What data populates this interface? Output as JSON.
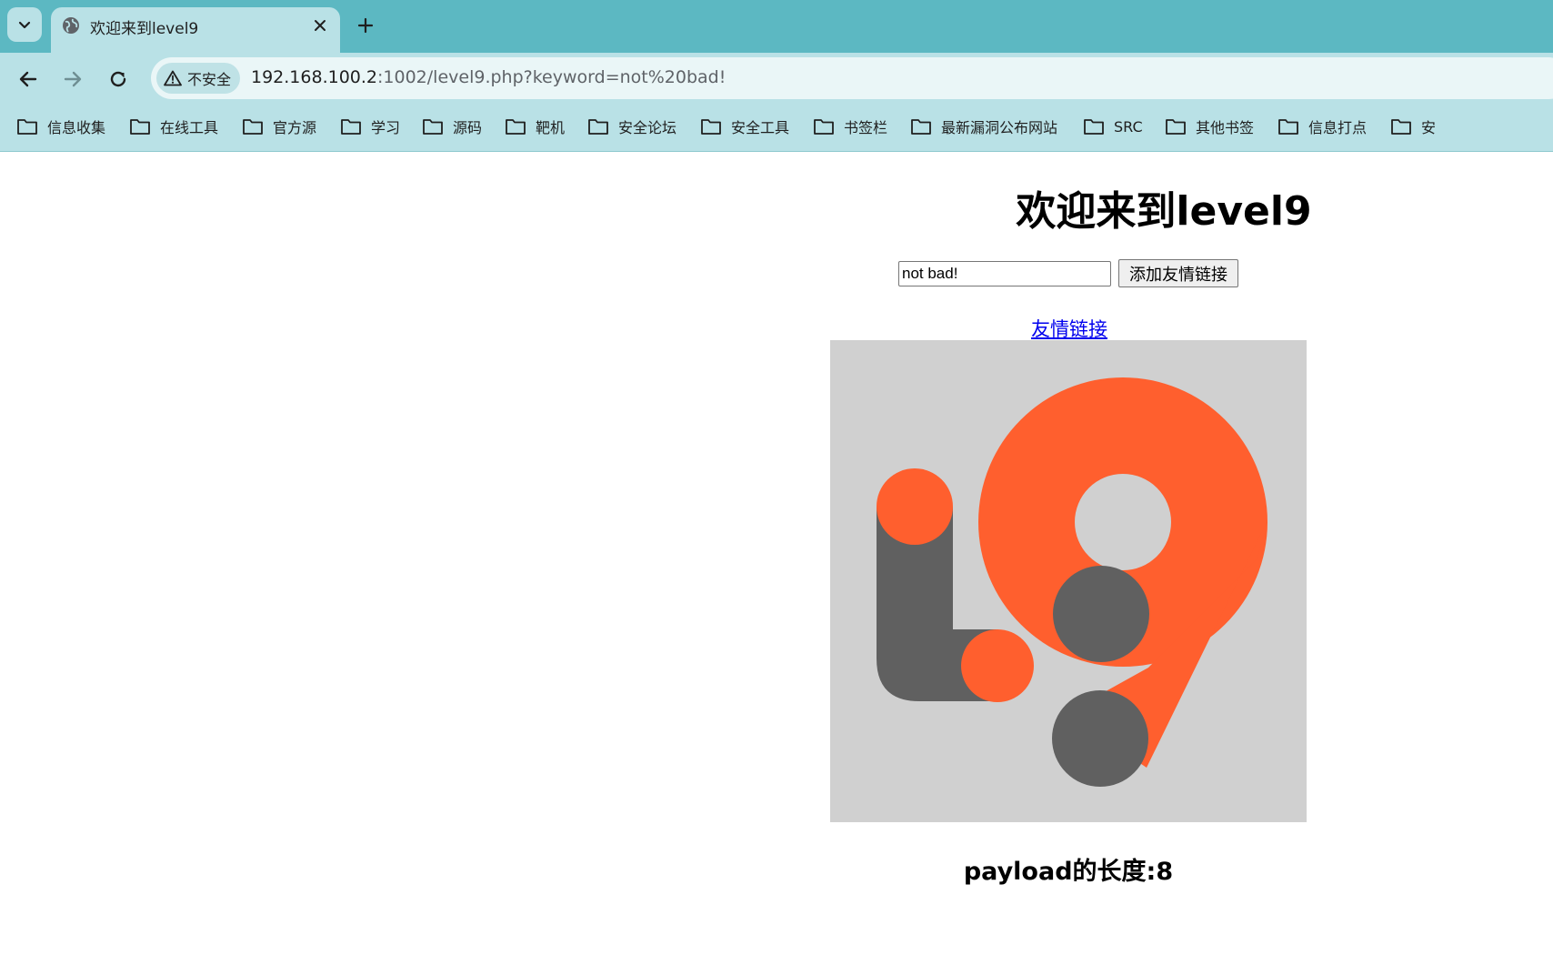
{
  "browser": {
    "tab": {
      "title": "欢迎来到level9",
      "favicon": "globe-icon"
    },
    "address_bar": {
      "security_label": "不安全",
      "url_host": "192.168.100.2",
      "url_rest": ":1002/level9.php?keyword=not%20bad!"
    },
    "bookmarks": [
      {
        "label": "信息收集"
      },
      {
        "label": "在线工具"
      },
      {
        "label": "官方源"
      },
      {
        "label": "学习"
      },
      {
        "label": "源码"
      },
      {
        "label": "靶机"
      },
      {
        "label": "安全论坛"
      },
      {
        "label": "安全工具"
      },
      {
        "label": "书签栏"
      },
      {
        "label": "最新漏洞公布网站"
      },
      {
        "label": "SRC"
      },
      {
        "label": "其他书签"
      },
      {
        "label": "信息打点"
      },
      {
        "label": "安"
      }
    ],
    "colors": {
      "tab_strip": "#5cb8c2",
      "toolbar": "#b9e1e6"
    }
  },
  "page": {
    "title": "欢迎来到level9",
    "keyword_input_value": "not bad!",
    "add_button_label": "添加友情链接",
    "friend_link_text": "友情链接",
    "image": {
      "description_icon": "level9-logo",
      "colors": {
        "background": "#d0d0d0",
        "orange": "#ff5f2e",
        "gray": "#606060"
      }
    },
    "payload_length_text": "payload的长度:8"
  }
}
